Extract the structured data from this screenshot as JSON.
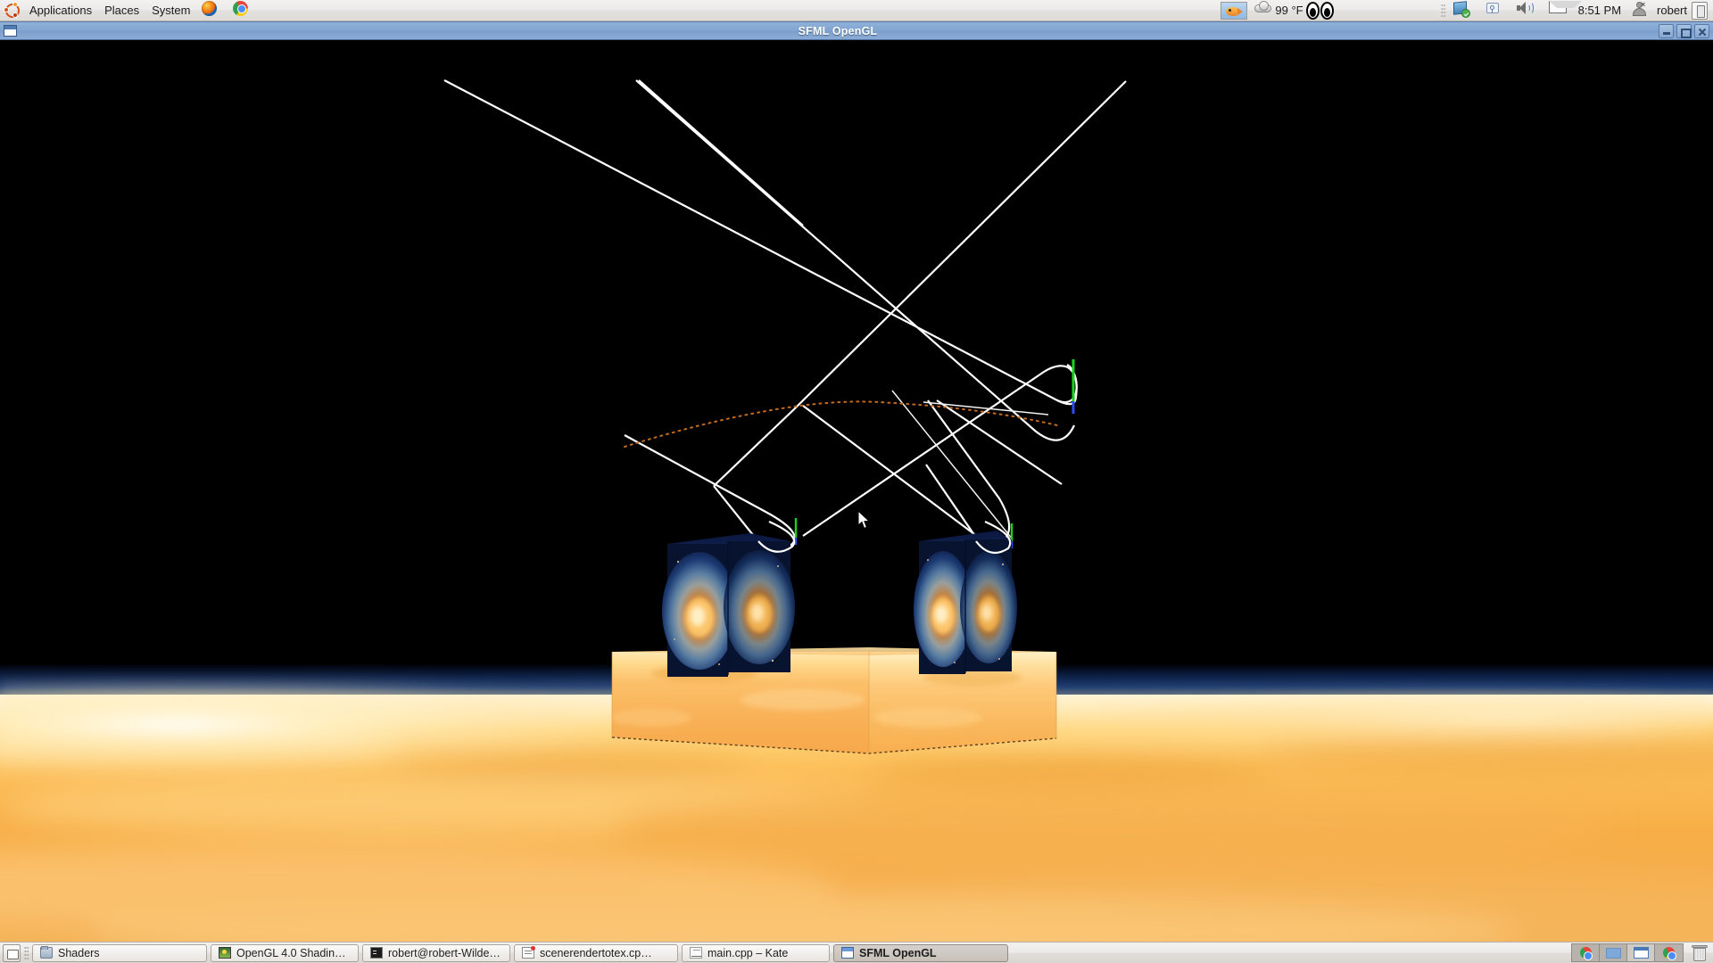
{
  "top_panel": {
    "logo": "ubuntu-logo",
    "menus": [
      {
        "label": "Applications",
        "name": "applications-menu"
      },
      {
        "label": "Places",
        "name": "places-menu"
      },
      {
        "label": "System",
        "name": "system-menu"
      }
    ],
    "launchers": [
      {
        "name": "firefox-icon",
        "icon": "firefox-icon"
      },
      {
        "name": "chrome-icon",
        "icon": "chrome-icon"
      }
    ],
    "tray": {
      "fish_applet": "fish-icon",
      "weather_icon": "cloud-icon",
      "temperature": "99 °F",
      "eyes_applet": "eyes-icon",
      "updates_icon": "updates-available-icon",
      "key_icon": "keyring-icon",
      "volume_icon": "speaker-icon",
      "mail_icon": "envelope-icon",
      "clock": "8:51 PM",
      "user_icon": "user-status-icon",
      "username": "robert",
      "power_icon": "shutdown-icon"
    }
  },
  "window": {
    "title": "SFML OpenGL",
    "icon": "window-icon",
    "controls": {
      "minimize": "Minimize",
      "maximize": "Maximize",
      "close": "Close"
    }
  },
  "scene": {
    "description": "OpenGL 3D render: two nebula-textured cubes sitting on a fire/lava textured platform over a glowing orange ground plane, with white wireframe spline curves across a black sky",
    "sky_color": "#000000",
    "ground_color": "#f2a649",
    "horizon_band_color": "#13264a",
    "wireframe_color": "#ffffff",
    "particle_trail_color": "#c46a1e",
    "axis_marker_green": "#22cc22",
    "axis_marker_blue": "#2244ee",
    "nebula_core_color": "#ffd28a",
    "nebula_edge_color": "#0d1c4a",
    "cursor_position": "962, 528"
  },
  "taskbar": {
    "show_desktop": "show-desktop-icon",
    "tasks": [
      {
        "label": "Shaders",
        "icon": "folder-icon",
        "active": false
      },
      {
        "label": "OpenGL 4.0 Shading L…",
        "icon": "image-viewer-icon",
        "active": false
      },
      {
        "label": "robert@robert-Wilde…",
        "icon": "terminal-icon",
        "active": false
      },
      {
        "label": "scenerendertotex.cp…",
        "icon": "kate-modified-icon",
        "active": false
      },
      {
        "label": "main.cpp – Kate",
        "icon": "text-editor-icon",
        "active": false
      },
      {
        "label": "SFML OpenGL",
        "icon": "window-icon",
        "active": true
      }
    ],
    "workspaces": [
      {
        "name": "workspace-1",
        "content": "chrome-icon",
        "selected": false
      },
      {
        "name": "workspace-2",
        "content": "blue-window",
        "selected": false
      },
      {
        "name": "workspace-3",
        "content": "active-window",
        "selected": true
      },
      {
        "name": "workspace-4",
        "content": "chrome-icon",
        "selected": false
      }
    ],
    "trash": "trash-icon"
  }
}
